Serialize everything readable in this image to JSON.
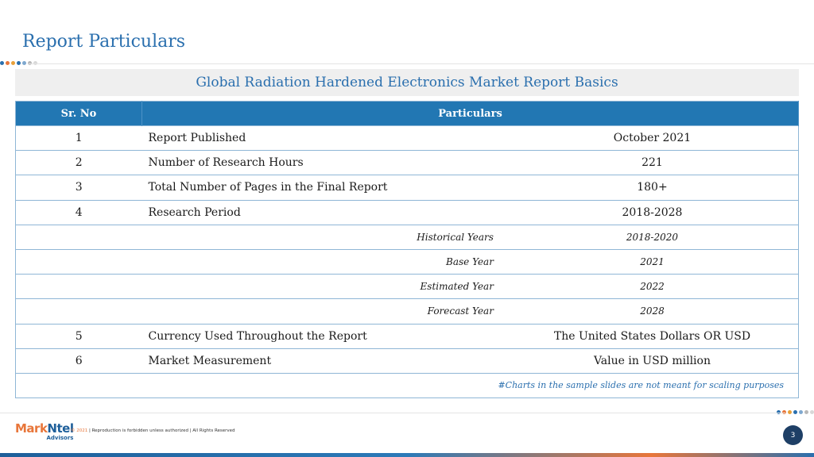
{
  "page": {
    "title": "Report Particulars",
    "subtitle": "Global Radiation Hardened Electronics Market Report Basics"
  },
  "table": {
    "headers": {
      "no": "Sr. No",
      "particulars": "Particulars"
    },
    "rows": [
      {
        "no": "1",
        "label": "Report Published",
        "value": "October 2021"
      },
      {
        "no": "2",
        "label": "Number of Research Hours",
        "value": "221"
      },
      {
        "no": "3",
        "label": "Total Number of Pages in the Final Report",
        "value": "180+"
      },
      {
        "no": "4",
        "label": "Research Period",
        "value": "2018-2028"
      },
      {
        "no": "5",
        "label": "Currency Used Throughout the Report",
        "value": "The United States Dollars OR USD"
      },
      {
        "no": "6",
        "label": "Market Measurement",
        "value": "Value in USD million"
      }
    ],
    "sub_rows": [
      {
        "label": "Historical Years",
        "value": "2018-2020"
      },
      {
        "label": "Base Year",
        "value": "2021"
      },
      {
        "label": "Estimated Year",
        "value": "2022"
      },
      {
        "label": "Forecast Year",
        "value": "2028"
      }
    ],
    "note": "#Charts in the sample slides are not meant for scaling purposes"
  },
  "footer": {
    "logo_mark": "Mark",
    "logo_ntel": "Ntel",
    "logo_sub": "Advisors",
    "copyright_year": "© 2021",
    "copyright_text": " | Reproduction is forbidden unless authorized | All Rights Reserved",
    "page_number": "3"
  },
  "colors": {
    "accent_blue": "#2a6fae",
    "header_blue": "#2277b3",
    "accent_orange": "#e8763a",
    "navy": "#1e3f66"
  }
}
